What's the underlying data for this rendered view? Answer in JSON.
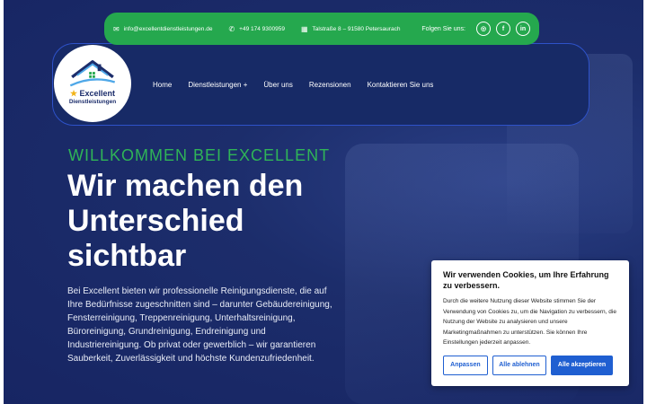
{
  "topbar": {
    "email": "info@excellentdienstleistungen.de",
    "phone": "+49 174 9300959",
    "address": "Talstraße 8 – 91580 Petersaurach",
    "follow_label": "Folgen Sie uns:",
    "social": [
      {
        "icon": "instagram-icon",
        "glyph": "◎"
      },
      {
        "icon": "facebook-icon",
        "glyph": "f"
      },
      {
        "icon": "linkedin-icon",
        "glyph": "in"
      }
    ]
  },
  "logo": {
    "name_line1": "Excellent",
    "name_line2": "Dienstleistungen"
  },
  "nav": {
    "items": [
      {
        "label": "Home"
      },
      {
        "label": "Dienstleistungen +"
      },
      {
        "label": "Über uns"
      },
      {
        "label": "Rezensionen"
      },
      {
        "label": "Kontaktieren Sie uns"
      }
    ]
  },
  "hero": {
    "tagline": "WILLKOMMEN BEI EXCELLENT",
    "headline": "Wir machen den Unterschied sichtbar",
    "intro": "Bei Excellent bieten wir professionelle Reinigungsdienste, die auf Ihre Bedürfnisse zugeschnitten sind – darunter Gebäudereinigung, Fensterreinigung, Treppenreinigung, Unterhaltsreinigung, Büroreinigung, Grundreinigung, Endreinigung und Industriereinigung. Ob privat oder gewerblich – wir garantieren Sauberkeit, Zuverlässigkeit und höchste Kundenzufriedenheit."
  },
  "cookie": {
    "title": "Wir verwenden Cookies, um Ihre Erfahrung zu verbessern.",
    "text": "Durch die weitere Nutzung dieser Website stimmen Sie der Verwendung von Cookies zu, um die Navigation zu verbessern, die Nutzung der Website zu analysieren und unsere Marketingmaßnahmen zu unterstützen. Sie können Ihre Einstellungen jederzeit anpassen.",
    "btn_customize": "Anpassen",
    "btn_reject": "Alle ablehnen",
    "btn_accept": "Alle akzeptieren"
  },
  "colors": {
    "brand_green": "#25a84e",
    "navy": "#172a66",
    "button_blue": "#1f5fd1"
  }
}
